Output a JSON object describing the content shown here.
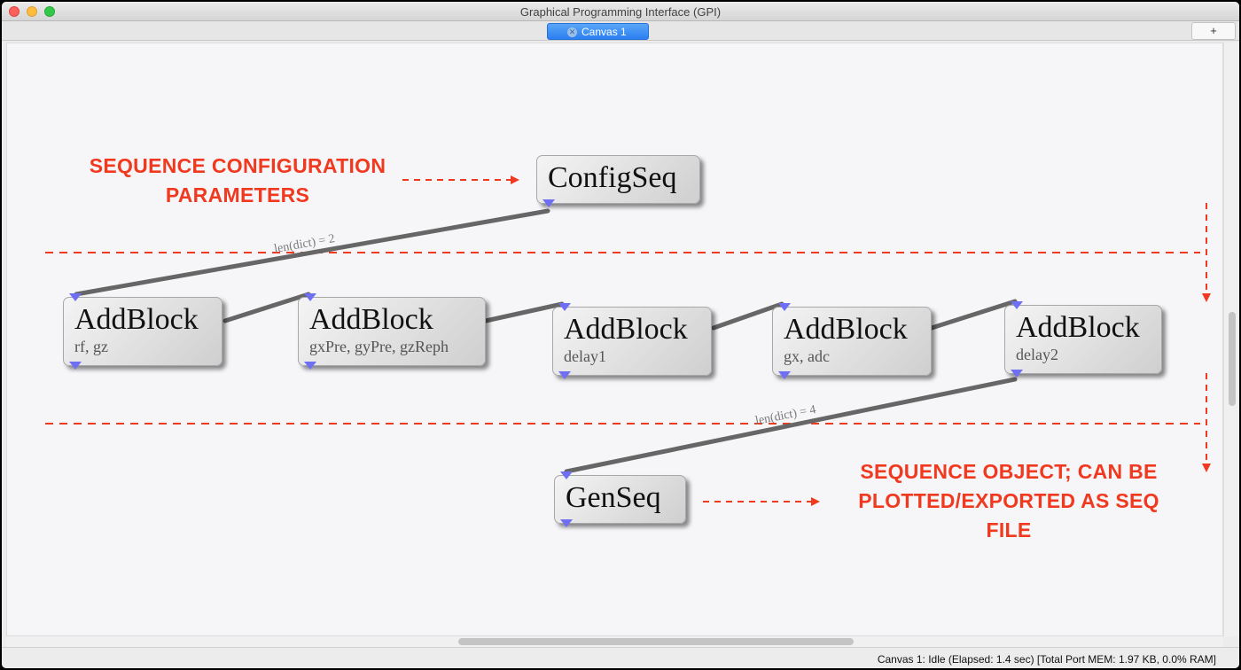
{
  "window": {
    "title": "Graphical Programming Interface (GPI)"
  },
  "tabs": {
    "active_label": "Canvas 1",
    "close_glyph": "✕",
    "add_label": "+"
  },
  "nodes": {
    "configseq": {
      "title": "ConfigSeq"
    },
    "addblock1": {
      "title": "AddBlock",
      "subtitle": "rf, gz"
    },
    "addblock2": {
      "title": "AddBlock",
      "subtitle": "gxPre, gyPre, gzReph"
    },
    "addblock3": {
      "title": "AddBlock",
      "subtitle": "delay1"
    },
    "addblock4": {
      "title": "AddBlock",
      "subtitle": "gx, adc"
    },
    "addblock5": {
      "title": "AddBlock",
      "subtitle": "delay2"
    },
    "genseq": {
      "title": "GenSeq"
    }
  },
  "wires": {
    "label_top": "len(dict) = 2",
    "label_bottom": "len(dict) = 4"
  },
  "annotations": {
    "config_line1": "SEQUENCE CONFIGURATION",
    "config_line2": "PARAMETERS",
    "seqobj_line1": "SEQUENCE OBJECT; CAN BE",
    "seqobj_line2": "PLOTTED/EXPORTED AS SEQ",
    "seqobj_line3": "FILE"
  },
  "status": {
    "text": "Canvas 1: Idle (Elapsed: 1.4 sec) [Total Port MEM: 1.97 KB, 0.0% RAM]"
  },
  "colors": {
    "annotation": "#f0391f",
    "port": "#6f6ff4",
    "wire": "#666666",
    "tab_active": "#2b7ff0"
  },
  "icons": {
    "tab_close": "close-icon",
    "add_tab": "plus-icon"
  }
}
